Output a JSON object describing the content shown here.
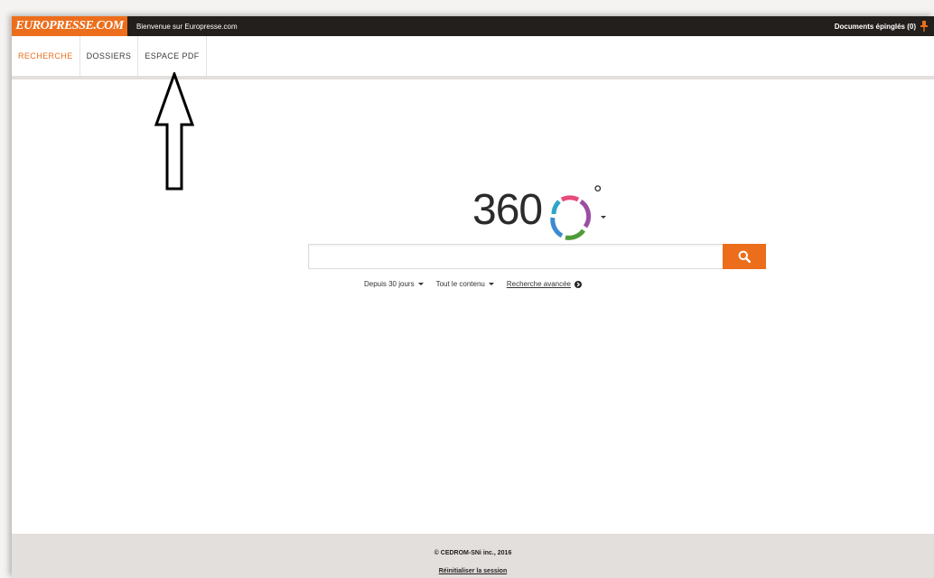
{
  "header": {
    "brand": "EUROPRESSE.COM",
    "welcome": "Bienvenue sur Europresse.com",
    "pinned_documents": "Documents épinglés (0)"
  },
  "nav": {
    "tabs": [
      {
        "label": "RECHERCHE",
        "active": true
      },
      {
        "label": "DOSSIERS",
        "active": false
      },
      {
        "label": "ESPACE PDF",
        "active": false
      }
    ]
  },
  "logo": {
    "text": "360",
    "degree": "°"
  },
  "search": {
    "value": "",
    "placeholder": ""
  },
  "filters": {
    "period": "Depuis 30 jours",
    "content": "Tout le contenu",
    "advanced": "Recherche avancée"
  },
  "footer": {
    "copyright": "© CEDROM-SNi inc., 2016",
    "reset_session": "Réinitialiser la session"
  },
  "colors": {
    "accent": "#ec6e1c",
    "topbar": "#231f1c",
    "footer_bg": "#e3dfdc"
  },
  "icons": [
    "pin-icon",
    "search-icon",
    "chevron-down-icon",
    "circle-arrow-icon",
    "upward-arrow-annotation"
  ]
}
